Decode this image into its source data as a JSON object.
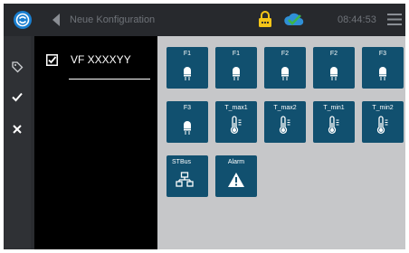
{
  "header": {
    "title": "Neue Konfiguration",
    "time": "08:44:53",
    "icons": [
      "logo-icon",
      "back-arrow-icon",
      "lock-icon",
      "cloud-check-icon",
      "menu-icon"
    ],
    "colors": {
      "bar": "#27292d",
      "logo": "#1a7fd0",
      "lock": "#f5c518",
      "cloud": "#2f8fd6",
      "check": "#3cb54a"
    }
  },
  "sidebar": {
    "icons": [
      "tag-icon",
      "check-icon",
      "close-icon"
    ]
  },
  "config_list": {
    "items": [
      {
        "label": "VF XXXXYY",
        "checked": true
      }
    ]
  },
  "tiles": [
    {
      "label": "F1",
      "icon": "bulb-icon"
    },
    {
      "label": "F1",
      "icon": "bulb-icon"
    },
    {
      "label": "F2",
      "icon": "bulb-icon"
    },
    {
      "label": "F2",
      "icon": "bulb-icon"
    },
    {
      "label": "F3",
      "icon": "bulb-icon"
    },
    {
      "label": "F3",
      "icon": "bulb-icon"
    },
    {
      "label": "T_max1",
      "icon": "thermometer-icon"
    },
    {
      "label": "T_max2",
      "icon": "thermometer-icon"
    },
    {
      "label": "T_min1",
      "icon": "thermometer-icon"
    },
    {
      "label": "T_min2",
      "icon": "thermometer-icon"
    },
    {
      "label": "STBus",
      "icon": "network-icon"
    },
    {
      "label": "Alarm",
      "icon": "warning-icon"
    }
  ],
  "tile_color": "#11506f"
}
